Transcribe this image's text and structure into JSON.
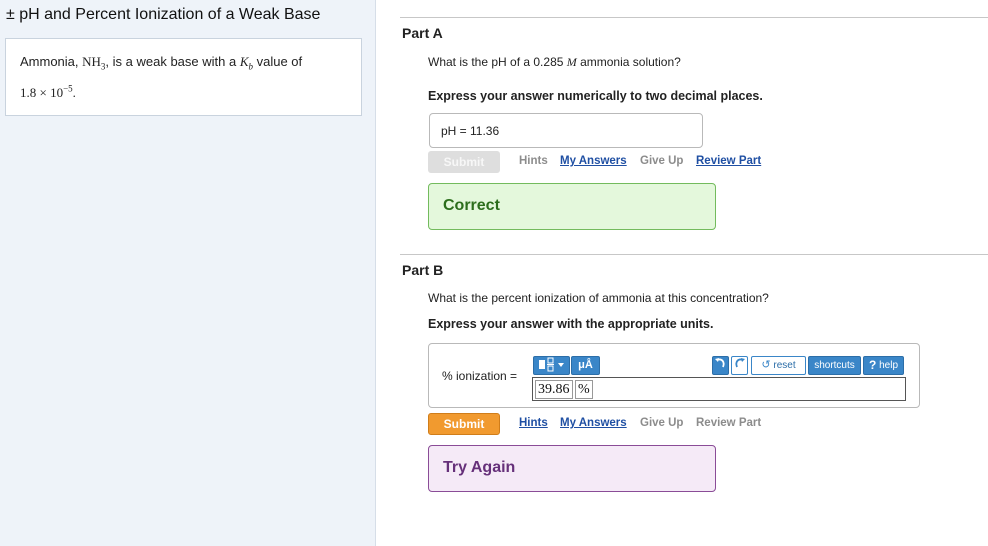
{
  "page": {
    "title": "± pH and Percent Ionization of a Weak Base"
  },
  "intro": {
    "text_pre": "Ammonia, ",
    "formula_base": "NH",
    "formula_sub": "3",
    "text_mid": ", is a weak base with a ",
    "kb_symbol": "K",
    "kb_sub": "b",
    "text_post": " value of",
    "value_base": "1.8 × 10",
    "value_exp": "−5",
    "value_end": "."
  },
  "part_a": {
    "label": "Part A",
    "question_pre": "What is the pH of a 0.285 ",
    "question_unit": "M",
    "question_post": " ammonia solution?",
    "instruction": "Express your answer numerically to two decimal places.",
    "answer_text": "pH =  11.36",
    "submit_label": "Submit",
    "hints_label": "Hints",
    "my_answers_label": "My Answers",
    "give_up_label": "Give Up",
    "review_part_label": "Review Part",
    "feedback": "Correct"
  },
  "part_b": {
    "label": "Part B",
    "question": "What is the percent ionization of ammonia at this concentration?",
    "instruction": "Express your answer with the appropriate units.",
    "input_label": "% ionization =",
    "value": "39.86",
    "unit": "%",
    "toolbar": {
      "units_label": "μÅ",
      "reset_label": "reset",
      "shortcuts_label": "shortcuts",
      "help_label": "help"
    },
    "submit_label": "Submit",
    "hints_label": "Hints",
    "my_answers_label": "My Answers",
    "give_up_label": "Give Up",
    "review_part_label": "Review Part",
    "feedback": "Try Again"
  },
  "colors": {
    "submit_active": "#f19a2f",
    "correct_bg": "#e4f8dc",
    "try_again_bg": "#f5eaf7",
    "link_blue": "#1f4fa3",
    "tool_blue": "#3a86c8"
  }
}
